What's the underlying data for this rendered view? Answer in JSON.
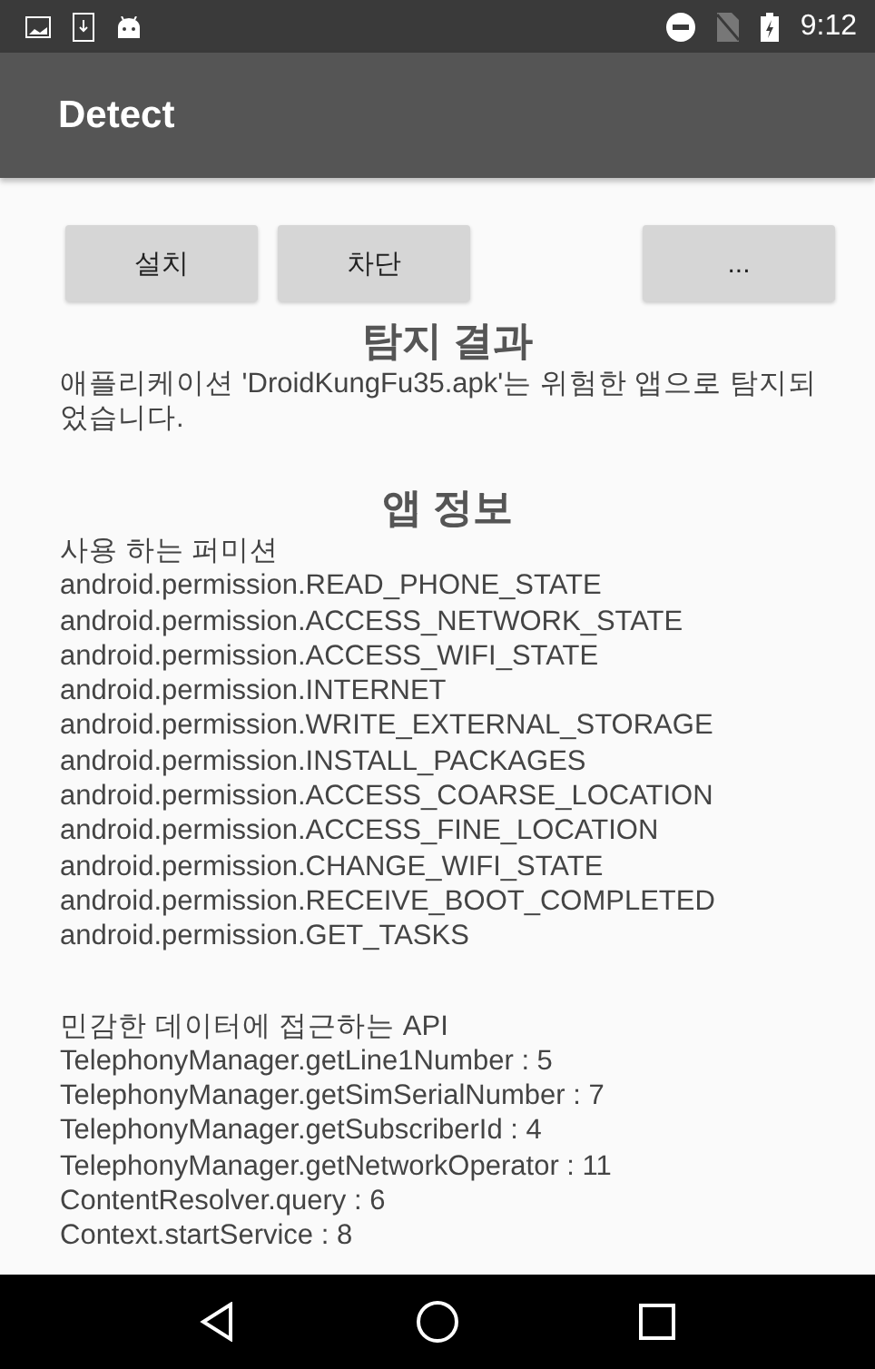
{
  "status_bar": {
    "time": "9:12"
  },
  "app_bar": {
    "title": "Detect"
  },
  "buttons": [
    {
      "label": "설치",
      "kind": "lead"
    },
    {
      "label": "차단",
      "kind": "lead"
    },
    {
      "label": "...",
      "kind": "trail"
    }
  ],
  "result": {
    "heading": "탐지 결과",
    "message": "애플리케이션 'DroidKungFu35.apk'는 위험한 앱으로 탐지되었습니다."
  },
  "app_info": {
    "heading": "앱 정보",
    "sections": [
      {
        "title": "사용 하는 퍼미션",
        "lines": [
          "android.permission.READ_PHONE_STATE",
          "android.permission.ACCESS_NETWORK_STATE",
          "android.permission.ACCESS_WIFI_STATE",
          "android.permission.INTERNET",
          "android.permission.WRITE_EXTERNAL_STORAGE",
          "android.permission.INSTALL_PACKAGES",
          "android.permission.ACCESS_COARSE_LOCATION",
          "android.permission.ACCESS_FINE_LOCATION",
          "android.permission.CHANGE_WIFI_STATE",
          "android.permission.RECEIVE_BOOT_COMPLETED",
          "android.permission.GET_TASKS"
        ]
      },
      {
        "title": "민감한 데이터에 접근하는 API",
        "lines": [
          "TelephonyManager.getLine1Number : 5",
          "TelephonyManager.getSimSerialNumber : 7",
          "TelephonyManager.getSubscriberId : 4",
          "TelephonyManager.getNetworkOperator : 11",
          "ContentResolver.query : 6",
          "Context.startService : 8"
        ]
      }
    ]
  }
}
